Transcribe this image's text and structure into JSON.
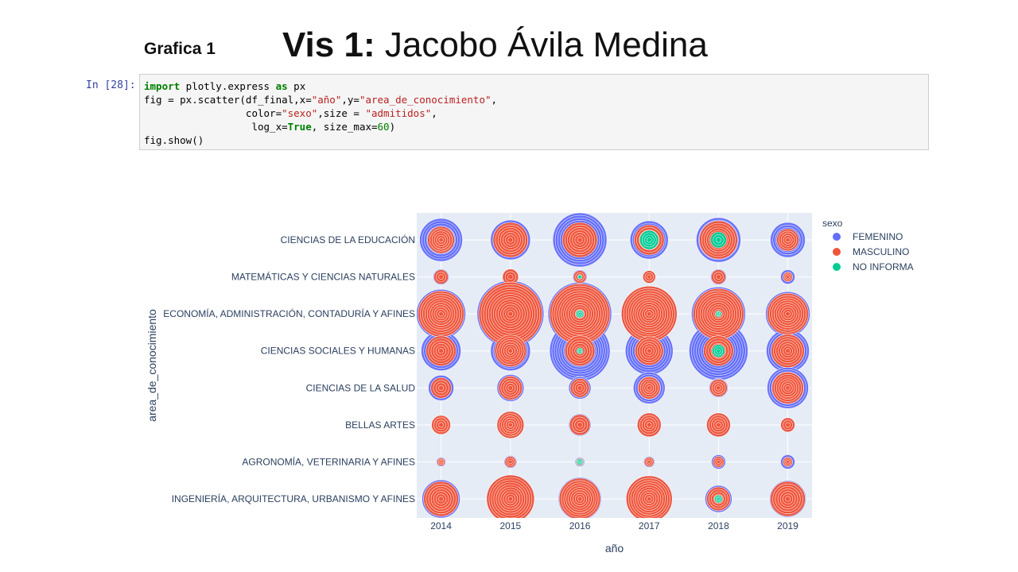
{
  "header": {
    "small_title": "Grafica 1",
    "title_bold": "Vis 1:",
    "title_rest": "Jacobo Ávila Medina"
  },
  "notebook": {
    "prompt": "In [28]:",
    "code_lines": [
      "import plotly.express as px",
      "fig = px.scatter(df_final,x=\"año\",y=\"area_de_conocimiento\",",
      "                 color=\"sexo\",size = \"admitidos\",",
      "                  log_x=True, size_max=60)",
      "fig.show()"
    ]
  },
  "colors": {
    "FEMENINO": "#636efa",
    "MASCULINO": "#ef553b",
    "NO INFORMA": "#00cc96",
    "plot_bg": "#e5ecf6",
    "grid": "#ffffff"
  },
  "chart_data": {
    "type": "scatter",
    "xlabel": "año",
    "ylabel": "area_de_conocimiento",
    "x_scale": "log",
    "x": [
      2014,
      2015,
      2016,
      2017,
      2018,
      2019
    ],
    "categories": [
      "CIENCIAS DE LA EDUCACIÓN",
      "MATEMÁTICAS Y CIENCIAS NATURALES",
      "ECONOMÍA, ADMINISTRACIÓN, CONTADURÍA Y AFINES",
      "CIENCIAS SOCIALES Y HUMANAS",
      "CIENCIAS DE LA SALUD",
      "BELLAS ARTES",
      "AGRONOMÍA, VETERINARIA Y AFINES",
      "INGENIERÍA, ARQUITECTURA, URBANISMO Y AFINES"
    ],
    "legend_title": "sexo",
    "legend_position": "top-right",
    "grid": true,
    "series": [
      {
        "name": "FEMENINO",
        "max_size": [
          [
            27,
            25,
            34,
            24,
            28,
            22
          ],
          [
            10,
            9,
            9,
            8,
            10,
            9
          ],
          [
            31,
            42,
            40,
            35,
            34,
            28
          ],
          [
            25,
            25,
            38,
            30,
            37,
            27
          ],
          [
            16,
            17,
            14,
            20,
            12,
            26
          ],
          [
            10,
            17,
            14,
            15,
            15,
            9
          ],
          [
            6,
            8,
            6,
            7,
            9,
            9
          ],
          [
            24,
            30,
            27,
            29,
            17,
            23
          ]
        ]
      },
      {
        "name": "MASCULINO",
        "max_size": [
          [
            17,
            22,
            22,
            19,
            24,
            14
          ],
          [
            9,
            10,
            8,
            8,
            9,
            6
          ],
          [
            29,
            40,
            38,
            35,
            32,
            26
          ],
          [
            19,
            20,
            19,
            18,
            19,
            21
          ],
          [
            13,
            15,
            12,
            14,
            11,
            20
          ],
          [
            12,
            17,
            13,
            15,
            15,
            9
          ],
          [
            5,
            7,
            5,
            6,
            7,
            6
          ],
          [
            22,
            30,
            26,
            29,
            15,
            22
          ]
        ]
      },
      {
        "name": "NO INFORMA",
        "max_size": [
          [
            0,
            0,
            0,
            12,
            10,
            0
          ],
          [
            0,
            0,
            3,
            0,
            0,
            0
          ],
          [
            0,
            0,
            5,
            0,
            4,
            0
          ],
          [
            0,
            0,
            4,
            0,
            8,
            0
          ],
          [
            0,
            0,
            0,
            0,
            0,
            0
          ],
          [
            0,
            0,
            0,
            0,
            0,
            0
          ],
          [
            0,
            0,
            4,
            0,
            0,
            0
          ],
          [
            0,
            0,
            0,
            0,
            5,
            0
          ]
        ]
      }
    ]
  }
}
